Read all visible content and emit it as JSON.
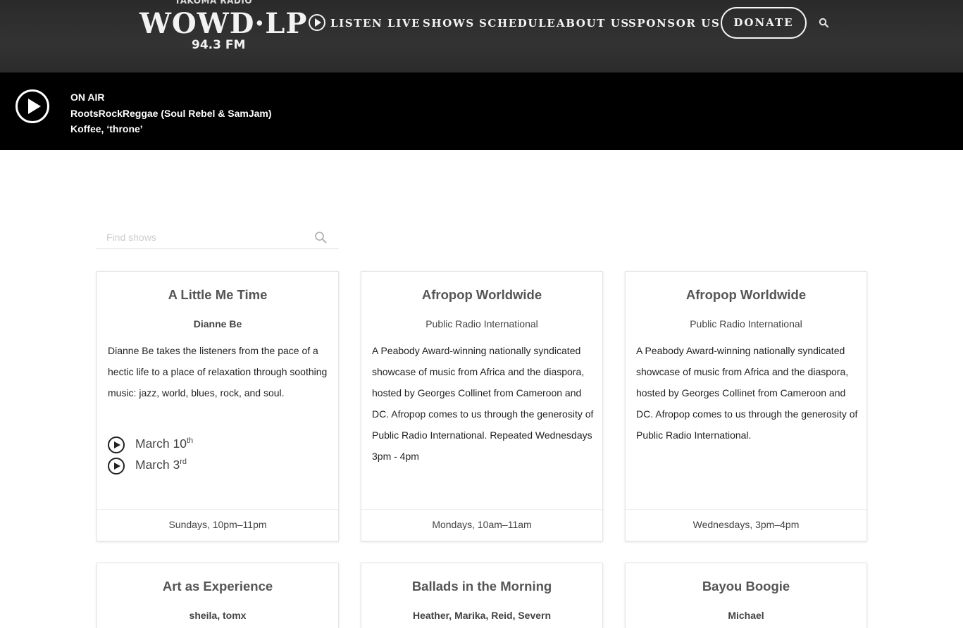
{
  "header": {
    "logo_tagline": "TAKOMA RADIO",
    "logo_mark": "WOWD·LP",
    "logo_freq": "94.3 FM",
    "nav": [
      {
        "label": "LISTEN LIVE"
      },
      {
        "label": "SHOWS"
      },
      {
        "label": "SCHEDULE"
      },
      {
        "label": "ABOUT US"
      },
      {
        "label": "SPONSOR US"
      }
    ],
    "donate_label": "DONATE",
    "search_icon": "search-icon"
  },
  "on_air": {
    "label": "ON AIR",
    "show": "RootsRockReggae (Soul Rebel & SamJam)",
    "track": "Koffee, ‘throne’"
  },
  "search": {
    "placeholder": "Find shows",
    "value": ""
  },
  "cards": [
    {
      "title": "A Little Me Time",
      "host": "Dianne Be",
      "description": "Dianne Be takes the listeners from the pace of a hectic life to a place of relaxation through soothing music: jazz, world, blues, rock, and soul.",
      "episodes": [
        {
          "date": "March 10",
          "suffix": "th"
        },
        {
          "date": "March 3",
          "suffix": "rd"
        }
      ],
      "schedule": "Sundays, 10pm–11pm"
    },
    {
      "title": "Afropop Worldwide",
      "host": "Public Radio International",
      "description": "A Peabody Award-winning nationally syndicated showcase of music from Africa and the diaspora, hosted by Georges Collinet from Cameroon and DC. Afropop comes to us through the generosity of Public Radio International. Repeated Wednesdays 3pm - 4pm",
      "schedule": "Mondays, 10am–11am"
    },
    {
      "title": "Afropop Worldwide",
      "host": "Public Radio International",
      "description": "A Peabody Award-winning nationally syndicated showcase of music from Africa and the diaspora, hosted by Georges Collinet from Cameroon and DC. Afropop comes to us through the generosity of Public Radio International.",
      "schedule": "Wednesdays, 3pm–4pm"
    },
    {
      "title": "Art as Experience",
      "host": "sheila, tomx"
    },
    {
      "title": "Ballads in the Morning",
      "host": "Heather, Marika, Reid, Severn"
    },
    {
      "title": "Bayou Boogie",
      "host": "Michael"
    }
  ]
}
